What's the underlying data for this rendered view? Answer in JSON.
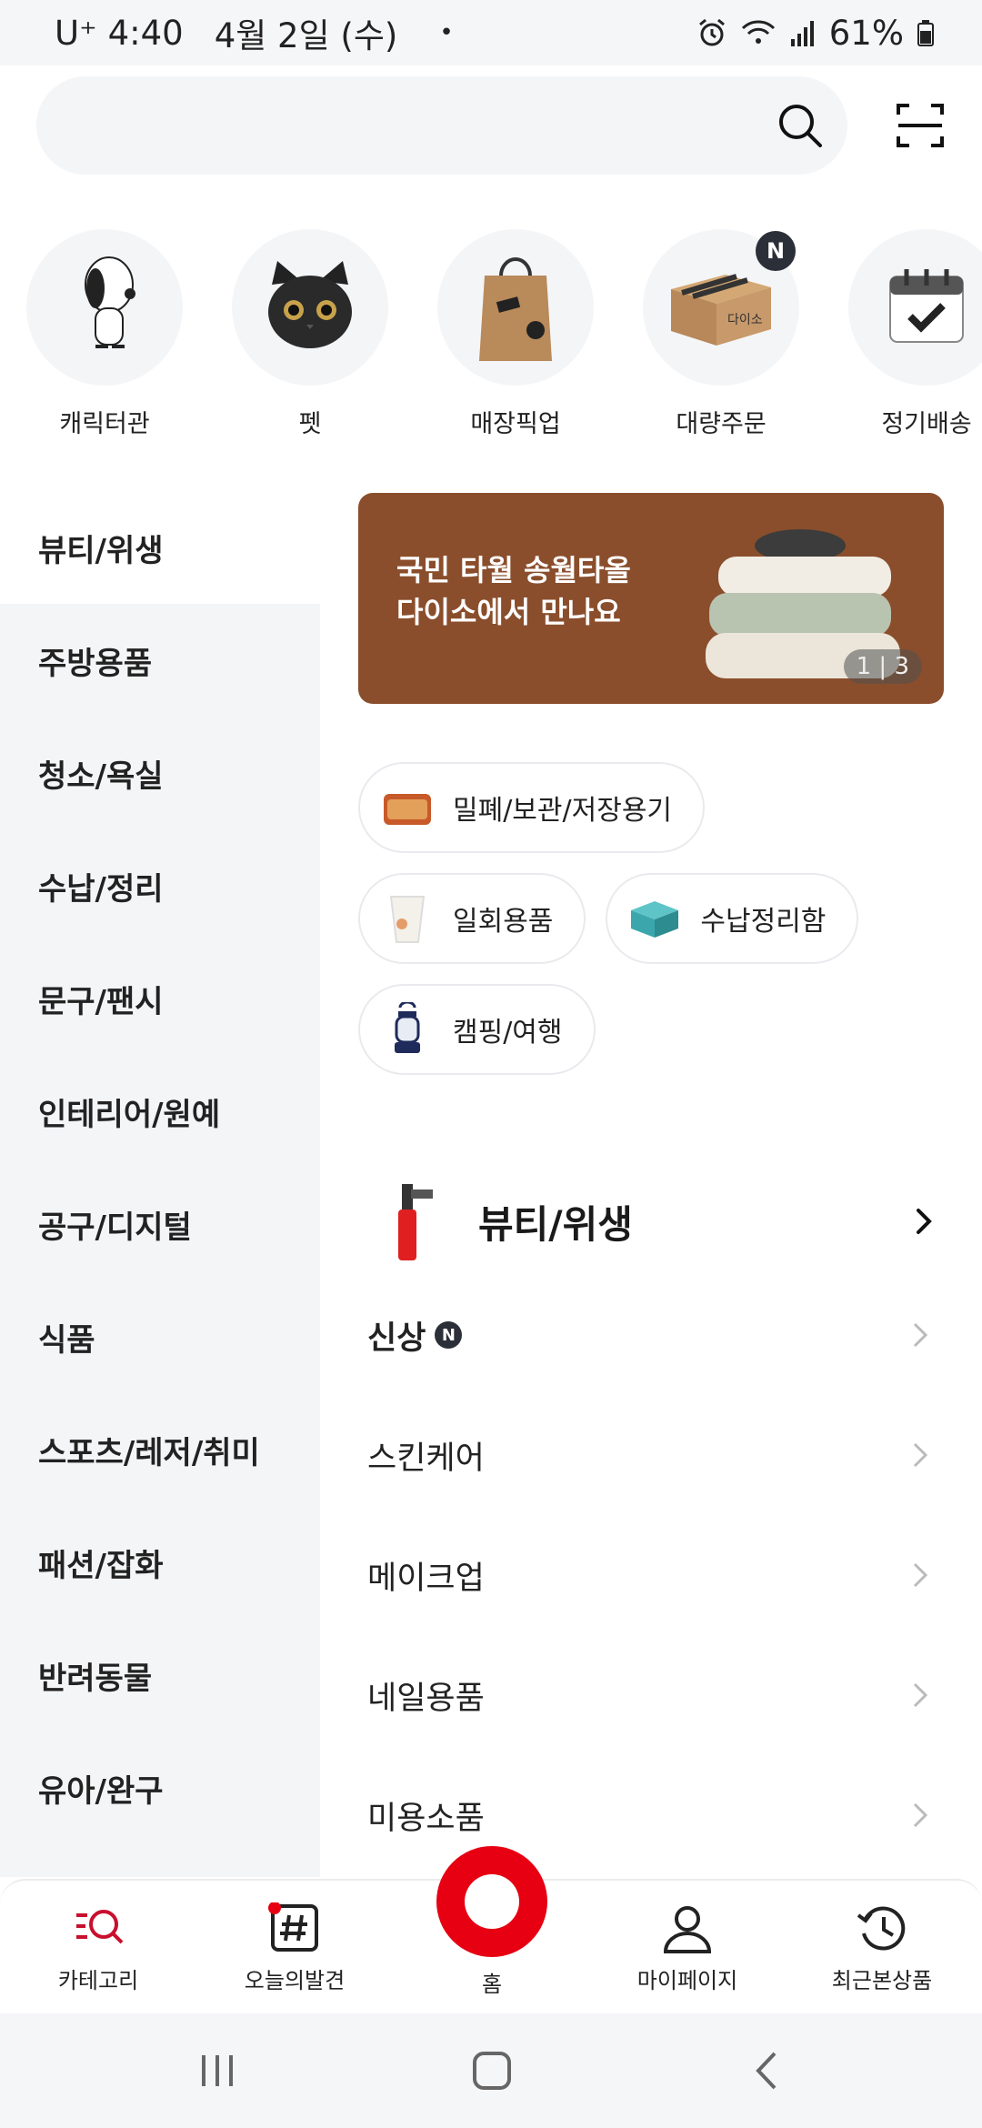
{
  "status_bar": {
    "carrier": "U⁺",
    "time": "4:40",
    "date": "4월 2일 (수)",
    "dot": "•",
    "battery": "61%"
  },
  "search": {
    "placeholder": ""
  },
  "quick_menu": [
    {
      "label": "캐릭터관",
      "icon": "snoopy-character-icon"
    },
    {
      "label": "펫",
      "icon": "black-cat-icon"
    },
    {
      "label": "매장픽업",
      "icon": "shopping-bag-icon"
    },
    {
      "label": "대량주문",
      "icon": "daiso-box-icon",
      "badge": "N"
    },
    {
      "label": "정기배송",
      "icon": "calendar-check-icon"
    }
  ],
  "sidebar": {
    "items": [
      {
        "label": "뷰티/위생"
      },
      {
        "label": "주방용품"
      },
      {
        "label": "청소/욕실"
      },
      {
        "label": "수납/정리"
      },
      {
        "label": "문구/팬시"
      },
      {
        "label": "인테리어/원예"
      },
      {
        "label": "공구/디지털"
      },
      {
        "label": "식품"
      },
      {
        "label": "스포츠/레저/취미"
      },
      {
        "label": "패션/잡화"
      },
      {
        "label": "반려동물"
      },
      {
        "label": "유아/완구"
      }
    ]
  },
  "banner": {
    "line1": "국민 타월 송월타올",
    "line2": "다이소에서 만나요",
    "counter": "1 | 3"
  },
  "chips": [
    {
      "label": "밀폐/보관/저장용기",
      "icon": "container-icon"
    },
    {
      "label": "일회용품",
      "icon": "paper-cup-icon"
    },
    {
      "label": "수납정리함",
      "icon": "storage-box-icon"
    },
    {
      "label": "캠핑/여행",
      "icon": "lantern-icon"
    }
  ],
  "section": {
    "title": "뷰티/위생"
  },
  "sub_items": [
    {
      "label": "신상",
      "badge": "N"
    },
    {
      "label": "스킨케어"
    },
    {
      "label": "메이크업"
    },
    {
      "label": "네일용품"
    },
    {
      "label": "미용소품"
    }
  ],
  "bottom_nav": {
    "category": "카테고리",
    "discover": "오늘의발견",
    "home": "홈",
    "mypage": "마이페이지",
    "recent": "최근본상품"
  },
  "colors": {
    "brand_red": "#e60012",
    "banner_brown": "#8a4e2c",
    "sidebar_bg": "#f4f5f7"
  }
}
